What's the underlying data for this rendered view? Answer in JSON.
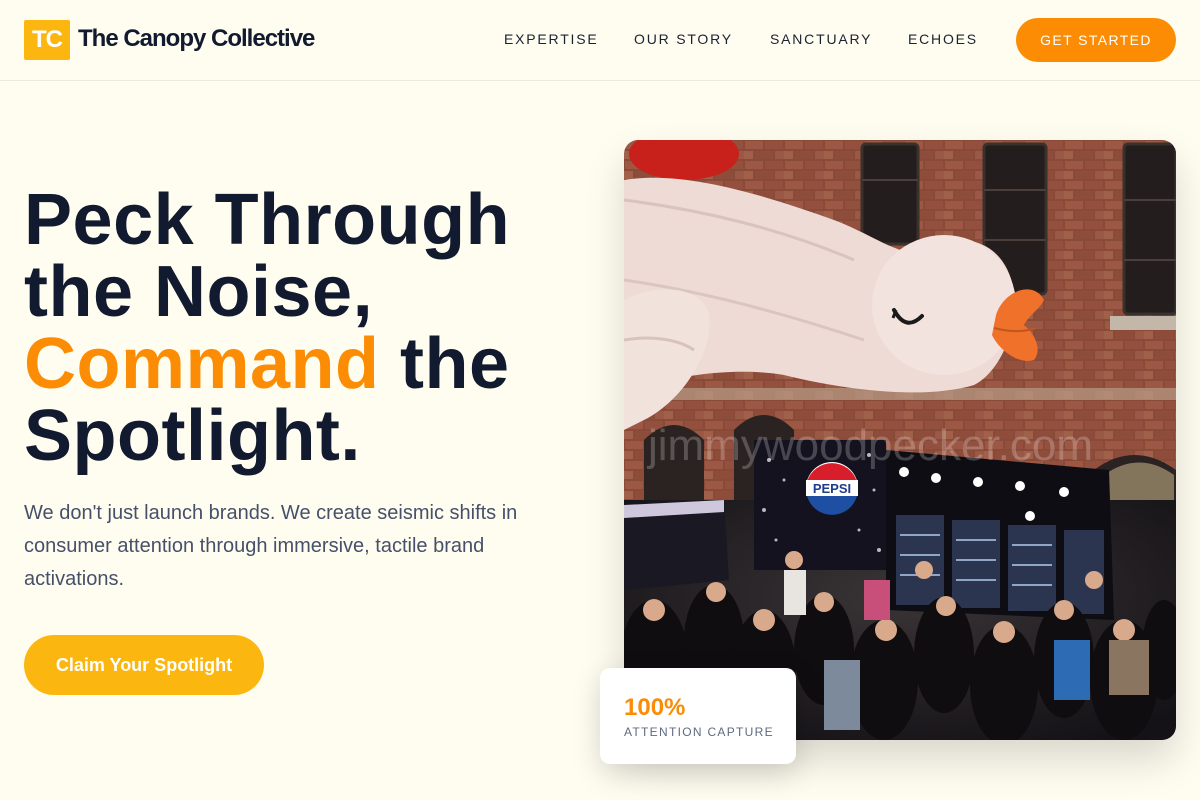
{
  "brand": {
    "logo_mark": "TC",
    "name": "The Canopy Collective",
    "accent_color": "#fb8c04",
    "secondary_color": "#fbb710",
    "background_color": "#fffdf0"
  },
  "nav": {
    "items": [
      {
        "label": "EXPERTISE"
      },
      {
        "label": "OUR STORY"
      },
      {
        "label": "SANCTUARY"
      },
      {
        "label": "ECHOES"
      }
    ],
    "cta_label": "GET STARTED"
  },
  "hero": {
    "title_line1": "Peck Through",
    "title_line2": "the Noise,",
    "title_accent": "Command",
    "title_line3_rest": " the",
    "title_line4": "Spotlight.",
    "subtitle": "We don't just launch brands. We create seismic shifts in consumer attention through immersive, tactile brand activations.",
    "cta_label": "Claim Your Spotlight"
  },
  "image": {
    "watermark": "jimmywoodpecker.com",
    "sign_text": "PEPSI"
  },
  "stat": {
    "value": "100%",
    "label": "ATTENTION CAPTURE"
  }
}
